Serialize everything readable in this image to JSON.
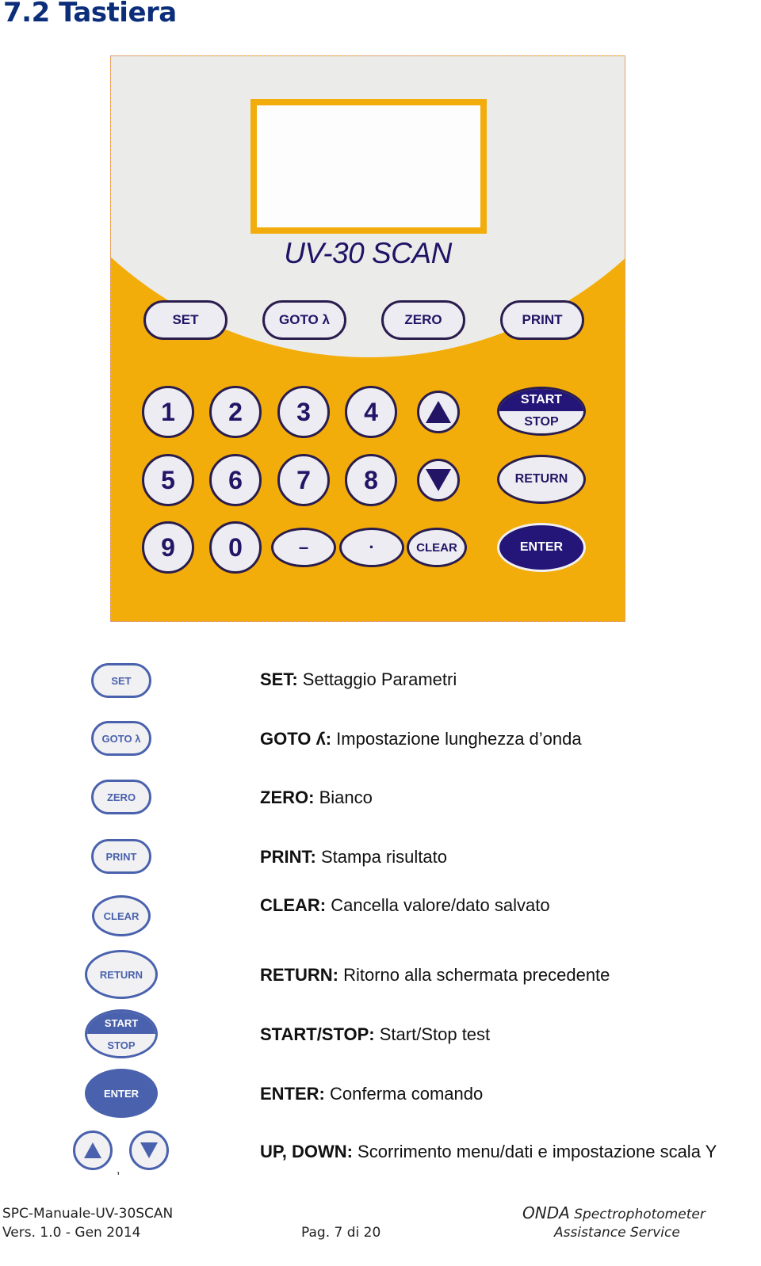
{
  "heading": "7.2 Tastiera",
  "keypad": {
    "model": "UV-30 SCAN",
    "function_keys": [
      "SET",
      "GOTO λ",
      "ZERO",
      "PRINT"
    ],
    "number_keys": [
      "1",
      "2",
      "3",
      "4",
      "5",
      "6",
      "7",
      "8",
      "9",
      "0"
    ],
    "minus_key": "–",
    "dot_key": "·",
    "clear_key": "CLEAR",
    "start_key": "START",
    "stop_key": "STOP",
    "return_key": "RETURN",
    "enter_key": "ENTER",
    "up_key_icon": "up-triangle",
    "down_key_icon": "down-triangle",
    "colors": {
      "panel": "#f3ad0a",
      "dome": "#ebebea",
      "key_text": "#231466",
      "dark_key": "#241578"
    }
  },
  "legend": [
    {
      "icon_label": "SET",
      "key": "SET:",
      "text": " Settaggio Parametri"
    },
    {
      "icon_label": "GOTO λ",
      "key": "GOTO ʎ:",
      "text": " Impostazione lunghezza d’onda"
    },
    {
      "icon_label": "ZERO",
      "key": "ZERO:",
      "text": " Bianco"
    },
    {
      "icon_label": "PRINT",
      "key": "PRINT:",
      "text": " Stampa risultato"
    },
    {
      "icon_label": "CLEAR",
      "key": "CLEAR:",
      "text": " Cancella valore/dato salvato"
    },
    {
      "icon_label": "RETURN",
      "key": "RETURN:",
      "text": " Ritorno alla schermata precedente"
    },
    {
      "icon_label_top": "START",
      "icon_label_bottom": "STOP",
      "key": "START/STOP:",
      "text": " Start/Stop test"
    },
    {
      "icon_label": "ENTER",
      "key": "ENTER:",
      "text": " Conferma comando"
    },
    {
      "key": "UP, DOWN:",
      "text": " Scorrimento menu/dati e impostazione scala Y",
      "separator": ","
    }
  ],
  "legend_color": "#4a62ad",
  "footer": {
    "doc_name": "SPC-Manuale-UV-30SCAN",
    "version": "Vers. 1.0 - Gen 2014",
    "page": "Pag. 7 di 20",
    "brand": "ONDA",
    "brand_sub": "Spectrophotometer",
    "service": "Assistance Service"
  }
}
